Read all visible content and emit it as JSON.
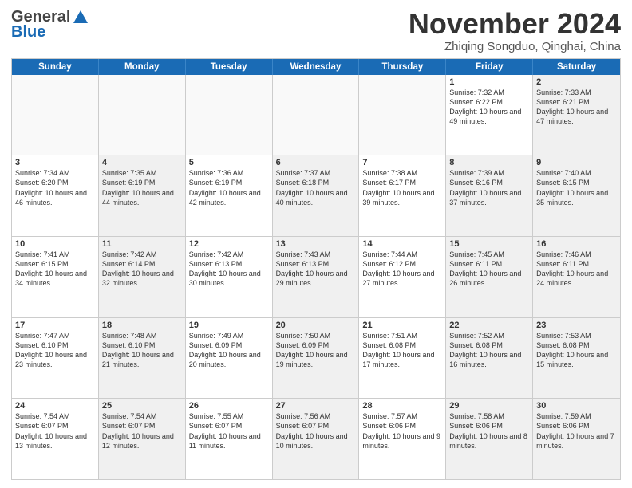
{
  "logo": {
    "general": "General",
    "blue": "Blue"
  },
  "title": "November 2024",
  "subtitle": "Zhiqing Songduo, Qinghai, China",
  "days_of_week": [
    "Sunday",
    "Monday",
    "Tuesday",
    "Wednesday",
    "Thursday",
    "Friday",
    "Saturday"
  ],
  "weeks": [
    {
      "cells": [
        {
          "empty": true
        },
        {
          "empty": true
        },
        {
          "empty": true
        },
        {
          "empty": true
        },
        {
          "empty": true
        },
        {
          "day": 1,
          "info": "Sunrise: 7:32 AM\nSunset: 6:22 PM\nDaylight: 10 hours and 49 minutes."
        },
        {
          "day": 2,
          "info": "Sunrise: 7:33 AM\nSunset: 6:21 PM\nDaylight: 10 hours and 47 minutes.",
          "shaded": true
        }
      ]
    },
    {
      "cells": [
        {
          "day": 3,
          "info": "Sunrise: 7:34 AM\nSunset: 6:20 PM\nDaylight: 10 hours and 46 minutes."
        },
        {
          "day": 4,
          "info": "Sunrise: 7:35 AM\nSunset: 6:19 PM\nDaylight: 10 hours and 44 minutes.",
          "shaded": true
        },
        {
          "day": 5,
          "info": "Sunrise: 7:36 AM\nSunset: 6:19 PM\nDaylight: 10 hours and 42 minutes."
        },
        {
          "day": 6,
          "info": "Sunrise: 7:37 AM\nSunset: 6:18 PM\nDaylight: 10 hours and 40 minutes.",
          "shaded": true
        },
        {
          "day": 7,
          "info": "Sunrise: 7:38 AM\nSunset: 6:17 PM\nDaylight: 10 hours and 39 minutes."
        },
        {
          "day": 8,
          "info": "Sunrise: 7:39 AM\nSunset: 6:16 PM\nDaylight: 10 hours and 37 minutes.",
          "shaded": true
        },
        {
          "day": 9,
          "info": "Sunrise: 7:40 AM\nSunset: 6:15 PM\nDaylight: 10 hours and 35 minutes.",
          "shaded": true
        }
      ]
    },
    {
      "cells": [
        {
          "day": 10,
          "info": "Sunrise: 7:41 AM\nSunset: 6:15 PM\nDaylight: 10 hours and 34 minutes."
        },
        {
          "day": 11,
          "info": "Sunrise: 7:42 AM\nSunset: 6:14 PM\nDaylight: 10 hours and 32 minutes.",
          "shaded": true
        },
        {
          "day": 12,
          "info": "Sunrise: 7:42 AM\nSunset: 6:13 PM\nDaylight: 10 hours and 30 minutes."
        },
        {
          "day": 13,
          "info": "Sunrise: 7:43 AM\nSunset: 6:13 PM\nDaylight: 10 hours and 29 minutes.",
          "shaded": true
        },
        {
          "day": 14,
          "info": "Sunrise: 7:44 AM\nSunset: 6:12 PM\nDaylight: 10 hours and 27 minutes."
        },
        {
          "day": 15,
          "info": "Sunrise: 7:45 AM\nSunset: 6:11 PM\nDaylight: 10 hours and 26 minutes.",
          "shaded": true
        },
        {
          "day": 16,
          "info": "Sunrise: 7:46 AM\nSunset: 6:11 PM\nDaylight: 10 hours and 24 minutes.",
          "shaded": true
        }
      ]
    },
    {
      "cells": [
        {
          "day": 17,
          "info": "Sunrise: 7:47 AM\nSunset: 6:10 PM\nDaylight: 10 hours and 23 minutes."
        },
        {
          "day": 18,
          "info": "Sunrise: 7:48 AM\nSunset: 6:10 PM\nDaylight: 10 hours and 21 minutes.",
          "shaded": true
        },
        {
          "day": 19,
          "info": "Sunrise: 7:49 AM\nSunset: 6:09 PM\nDaylight: 10 hours and 20 minutes."
        },
        {
          "day": 20,
          "info": "Sunrise: 7:50 AM\nSunset: 6:09 PM\nDaylight: 10 hours and 19 minutes.",
          "shaded": true
        },
        {
          "day": 21,
          "info": "Sunrise: 7:51 AM\nSunset: 6:08 PM\nDaylight: 10 hours and 17 minutes."
        },
        {
          "day": 22,
          "info": "Sunrise: 7:52 AM\nSunset: 6:08 PM\nDaylight: 10 hours and 16 minutes.",
          "shaded": true
        },
        {
          "day": 23,
          "info": "Sunrise: 7:53 AM\nSunset: 6:08 PM\nDaylight: 10 hours and 15 minutes.",
          "shaded": true
        }
      ]
    },
    {
      "cells": [
        {
          "day": 24,
          "info": "Sunrise: 7:54 AM\nSunset: 6:07 PM\nDaylight: 10 hours and 13 minutes."
        },
        {
          "day": 25,
          "info": "Sunrise: 7:54 AM\nSunset: 6:07 PM\nDaylight: 10 hours and 12 minutes.",
          "shaded": true
        },
        {
          "day": 26,
          "info": "Sunrise: 7:55 AM\nSunset: 6:07 PM\nDaylight: 10 hours and 11 minutes."
        },
        {
          "day": 27,
          "info": "Sunrise: 7:56 AM\nSunset: 6:07 PM\nDaylight: 10 hours and 10 minutes.",
          "shaded": true
        },
        {
          "day": 28,
          "info": "Sunrise: 7:57 AM\nSunset: 6:06 PM\nDaylight: 10 hours and 9 minutes."
        },
        {
          "day": 29,
          "info": "Sunrise: 7:58 AM\nSunset: 6:06 PM\nDaylight: 10 hours and 8 minutes.",
          "shaded": true
        },
        {
          "day": 30,
          "info": "Sunrise: 7:59 AM\nSunset: 6:06 PM\nDaylight: 10 hours and 7 minutes.",
          "shaded": true
        }
      ]
    }
  ]
}
